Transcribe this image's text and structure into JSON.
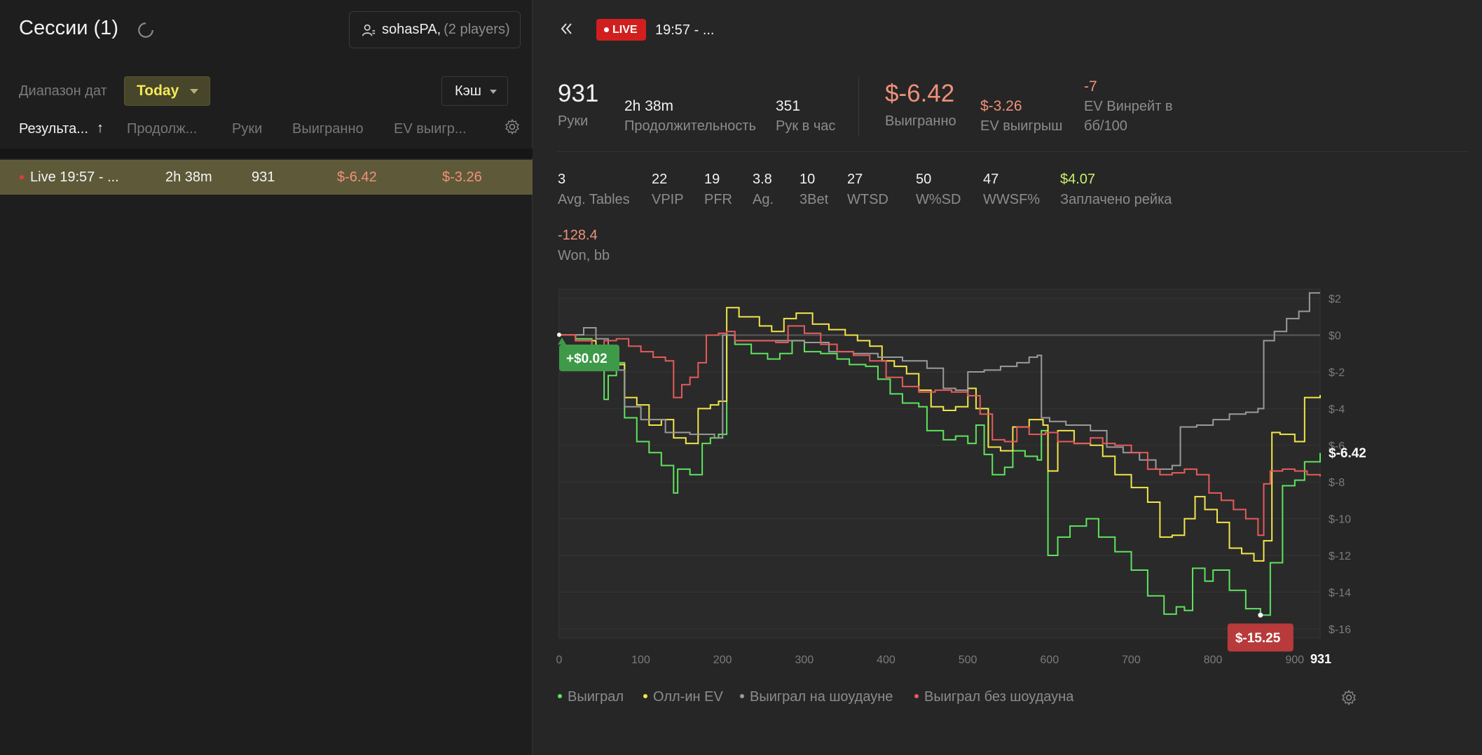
{
  "left": {
    "title": "Сессии (1)",
    "player_name": "sohasPA,",
    "player_count": "(2 players)",
    "date_range_label": "Диапазон дат",
    "date_range_value": "Today",
    "game_type": "Кэш",
    "columns": [
      "Результа...",
      "Продолж...",
      "Руки",
      "Выигранно",
      "EV выигр..."
    ],
    "sort_indicator": "↑",
    "sessions": [
      {
        "name": "Live 19:57 - ...",
        "duration": "2h 38m",
        "hands": "931",
        "won": "$-6.42",
        "ev_won": "$-3.26"
      }
    ]
  },
  "right": {
    "live_badge": "LIVE",
    "session_title": "19:57 - ...",
    "stats_main": [
      {
        "value": "931",
        "label": "Руки"
      },
      {
        "value": "2h 38m",
        "label": "Продолжительность"
      },
      {
        "value": "351",
        "label": "Рук в час"
      },
      {
        "value": "$-6.42",
        "label": "Выигранно"
      },
      {
        "value": "$-3.26",
        "label": "EV выигрыш"
      },
      {
        "value": "-7",
        "label_line1": "EV Винрейт в",
        "label_line2": "бб/100"
      }
    ],
    "stats_secondary": [
      {
        "value": "3",
        "label": "Avg. Tables"
      },
      {
        "value": "22",
        "label": "VPIP"
      },
      {
        "value": "19",
        "label": "PFR"
      },
      {
        "value": "3.8",
        "label": "Ag."
      },
      {
        "value": "10",
        "label": "3Bet"
      },
      {
        "value": "27",
        "label": "WTSD"
      },
      {
        "value": "50",
        "label": "W%SD"
      },
      {
        "value": "47",
        "label": "WWSF%"
      },
      {
        "value": "$4.07",
        "label": "Заплачено рейка"
      }
    ],
    "stats_extra": {
      "value": "-128.4",
      "label": "Won, bb"
    },
    "legend": [
      "Выиграл",
      "Олл-ин EV",
      "Выиграл на шоудауне",
      "Выиграл без шоудауна"
    ]
  },
  "colors": {
    "won": "#5ee35e",
    "allin_ev": "#f2e64a",
    "showdown": "#9a9a9a",
    "non_showdown": "#e85a5a",
    "accent_yellow": "#f3e85a",
    "negative": "#f0917a",
    "live_red": "#d11f1f"
  },
  "chart_data": {
    "type": "line",
    "xlim": [
      0,
      931
    ],
    "ylim": [
      -16.5,
      2.5
    ],
    "x_ticks": [
      "0",
      "100",
      "200",
      "300",
      "400",
      "500",
      "600",
      "700",
      "800",
      "900"
    ],
    "x_end_label": "931",
    "y_ticks": [
      "$2",
      "$0",
      "$-2",
      "$-4",
      "$-6",
      "$-8",
      "$-10",
      "$-12",
      "$-14",
      "$-16"
    ],
    "max_label": "+$0.02",
    "min_label": "$-15.25",
    "final_label": "$-6.42",
    "max_point": {
      "x": 0,
      "y": 0.02
    },
    "min_point": {
      "x": 858,
      "y": -15.25
    },
    "series": [
      {
        "name": "Выиграл",
        "color": "#5ee35e",
        "points": [
          [
            0,
            0.02
          ],
          [
            20,
            -0.2
          ],
          [
            40,
            -1.6
          ],
          [
            55,
            -3.5
          ],
          [
            60,
            -2.2
          ],
          [
            70,
            -1.5
          ],
          [
            80,
            -4.5
          ],
          [
            95,
            -5.8
          ],
          [
            110,
            -6.4
          ],
          [
            125,
            -7.1
          ],
          [
            140,
            -8.6
          ],
          [
            145,
            -7.3
          ],
          [
            160,
            -7.6
          ],
          [
            175,
            -5.9
          ],
          [
            185,
            -5.6
          ],
          [
            195,
            -5.4
          ],
          [
            205,
            0.0
          ],
          [
            215,
            -0.5
          ],
          [
            235,
            -1.0
          ],
          [
            255,
            -1.3
          ],
          [
            270,
            -1.0
          ],
          [
            285,
            -0.3
          ],
          [
            300,
            -0.9
          ],
          [
            320,
            -1.0
          ],
          [
            340,
            -1.3
          ],
          [
            355,
            -1.6
          ],
          [
            375,
            -1.7
          ],
          [
            390,
            -2.4
          ],
          [
            405,
            -3.2
          ],
          [
            420,
            -3.7
          ],
          [
            440,
            -3.9
          ],
          [
            450,
            -5.2
          ],
          [
            470,
            -5.7
          ],
          [
            485,
            -5.5
          ],
          [
            500,
            -5.9
          ],
          [
            510,
            -4.9
          ],
          [
            520,
            -6.5
          ],
          [
            530,
            -7.6
          ],
          [
            545,
            -7.2
          ],
          [
            555,
            -6.3
          ],
          [
            570,
            -6.6
          ],
          [
            585,
            -6.8
          ],
          [
            590,
            -5.2
          ],
          [
            598,
            -12.0
          ],
          [
            610,
            -11.0
          ],
          [
            625,
            -10.4
          ],
          [
            645,
            -10.0
          ],
          [
            660,
            -11.0
          ],
          [
            680,
            -11.8
          ],
          [
            700,
            -12.8
          ],
          [
            720,
            -14.2
          ],
          [
            740,
            -15.2
          ],
          [
            755,
            -14.8
          ],
          [
            765,
            -15.0
          ],
          [
            775,
            -12.7
          ],
          [
            790,
            -13.4
          ],
          [
            800,
            -12.8
          ],
          [
            820,
            -13.9
          ],
          [
            840,
            -14.9
          ],
          [
            858,
            -15.25
          ],
          [
            870,
            -12.4
          ],
          [
            885,
            -8.2
          ],
          [
            900,
            -7.9
          ],
          [
            912,
            -6.9
          ],
          [
            931,
            -6.42
          ]
        ]
      },
      {
        "name": "Олл-ин EV",
        "color": "#f2e64a",
        "points": [
          [
            0,
            0.02
          ],
          [
            20,
            -0.3
          ],
          [
            45,
            -1.2
          ],
          [
            60,
            -1.6
          ],
          [
            80,
            -3.4
          ],
          [
            95,
            -3.8
          ],
          [
            110,
            -4.9
          ],
          [
            125,
            -4.6
          ],
          [
            140,
            -5.6
          ],
          [
            155,
            -5.9
          ],
          [
            170,
            -4.0
          ],
          [
            185,
            -3.8
          ],
          [
            195,
            -3.6
          ],
          [
            205,
            1.5
          ],
          [
            220,
            1.0
          ],
          [
            245,
            0.5
          ],
          [
            260,
            0.2
          ],
          [
            275,
            0.9
          ],
          [
            290,
            1.2
          ],
          [
            310,
            0.6
          ],
          [
            330,
            0.3
          ],
          [
            350,
            0.0
          ],
          [
            365,
            -0.3
          ],
          [
            380,
            -0.6
          ],
          [
            395,
            -1.4
          ],
          [
            410,
            -1.7
          ],
          [
            425,
            -2.1
          ],
          [
            440,
            -3.0
          ],
          [
            455,
            -3.9
          ],
          [
            470,
            -4.1
          ],
          [
            485,
            -3.9
          ],
          [
            500,
            -2.9
          ],
          [
            510,
            -4.0
          ],
          [
            525,
            -6.1
          ],
          [
            540,
            -6.3
          ],
          [
            555,
            -5.0
          ],
          [
            575,
            -4.6
          ],
          [
            592,
            -4.9
          ],
          [
            598,
            -7.4
          ],
          [
            610,
            -5.2
          ],
          [
            630,
            -5.9
          ],
          [
            650,
            -6.0
          ],
          [
            665,
            -6.6
          ],
          [
            680,
            -7.6
          ],
          [
            700,
            -8.3
          ],
          [
            720,
            -9.1
          ],
          [
            735,
            -11.0
          ],
          [
            750,
            -10.9
          ],
          [
            765,
            -10.0
          ],
          [
            778,
            -8.8
          ],
          [
            790,
            -9.5
          ],
          [
            805,
            -10.2
          ],
          [
            820,
            -11.6
          ],
          [
            835,
            -11.9
          ],
          [
            850,
            -12.3
          ],
          [
            862,
            -11.2
          ],
          [
            872,
            -5.3
          ],
          [
            882,
            -5.4
          ],
          [
            900,
            -5.8
          ],
          [
            912,
            -3.4
          ],
          [
            931,
            -3.26
          ]
        ]
      },
      {
        "name": "Выиграл на шоудауне",
        "color": "#9a9a9a",
        "points": [
          [
            0,
            0.02
          ],
          [
            30,
            0.4
          ],
          [
            45,
            -0.2
          ],
          [
            60,
            -1.9
          ],
          [
            80,
            -3.9
          ],
          [
            100,
            -4.6
          ],
          [
            130,
            -5.3
          ],
          [
            160,
            -5.4
          ],
          [
            190,
            -5.6
          ],
          [
            200,
            0.0
          ],
          [
            215,
            -0.3
          ],
          [
            240,
            -0.3
          ],
          [
            270,
            -0.3
          ],
          [
            300,
            -0.4
          ],
          [
            330,
            -0.9
          ],
          [
            360,
            -1.0
          ],
          [
            390,
            -1.2
          ],
          [
            420,
            -1.4
          ],
          [
            450,
            -1.8
          ],
          [
            470,
            -2.9
          ],
          [
            485,
            -3.0
          ],
          [
            500,
            -2.0
          ],
          [
            520,
            -1.9
          ],
          [
            540,
            -1.7
          ],
          [
            560,
            -1.5
          ],
          [
            575,
            -1.2
          ],
          [
            585,
            -1.1
          ],
          [
            590,
            -4.5
          ],
          [
            600,
            -4.7
          ],
          [
            620,
            -4.9
          ],
          [
            650,
            -5.2
          ],
          [
            670,
            -6.1
          ],
          [
            690,
            -6.4
          ],
          [
            710,
            -6.8
          ],
          [
            730,
            -7.3
          ],
          [
            750,
            -7.1
          ],
          [
            760,
            -5.0
          ],
          [
            780,
            -4.9
          ],
          [
            800,
            -4.6
          ],
          [
            820,
            -4.3
          ],
          [
            840,
            -4.2
          ],
          [
            855,
            -4.0
          ],
          [
            862,
            -0.3
          ],
          [
            875,
            0.2
          ],
          [
            890,
            0.9
          ],
          [
            905,
            1.3
          ],
          [
            918,
            2.3
          ],
          [
            931,
            2.3
          ]
        ]
      },
      {
        "name": "Выиграл без шоудауна",
        "color": "#e85a5a",
        "points": [
          [
            0,
            0.02
          ],
          [
            20,
            -0.3
          ],
          [
            40,
            -0.6
          ],
          [
            55,
            -0.3
          ],
          [
            70,
            -0.2
          ],
          [
            85,
            -0.6
          ],
          [
            100,
            -0.9
          ],
          [
            115,
            -1.2
          ],
          [
            130,
            -1.4
          ],
          [
            140,
            -3.4
          ],
          [
            150,
            -2.7
          ],
          [
            160,
            -2.3
          ],
          [
            170,
            -1.5
          ],
          [
            180,
            0.0
          ],
          [
            195,
            0.1
          ],
          [
            205,
            0.2
          ],
          [
            215,
            -0.3
          ],
          [
            240,
            -0.3
          ],
          [
            265,
            -0.4
          ],
          [
            280,
            0.5
          ],
          [
            300,
            0.1
          ],
          [
            320,
            -0.5
          ],
          [
            340,
            -0.9
          ],
          [
            360,
            -1.1
          ],
          [
            380,
            -1.4
          ],
          [
            400,
            -2.3
          ],
          [
            420,
            -2.8
          ],
          [
            440,
            -3.1
          ],
          [
            460,
            -3.0
          ],
          [
            480,
            -3.1
          ],
          [
            500,
            -3.3
          ],
          [
            515,
            -4.3
          ],
          [
            530,
            -5.7
          ],
          [
            545,
            -5.8
          ],
          [
            560,
            -5.0
          ],
          [
            575,
            -5.4
          ],
          [
            595,
            -5.3
          ],
          [
            610,
            -5.8
          ],
          [
            630,
            -5.9
          ],
          [
            650,
            -5.6
          ],
          [
            665,
            -5.9
          ],
          [
            680,
            -6.0
          ],
          [
            700,
            -6.4
          ],
          [
            720,
            -7.3
          ],
          [
            735,
            -7.6
          ],
          [
            750,
            -7.5
          ],
          [
            765,
            -7.3
          ],
          [
            780,
            -7.6
          ],
          [
            795,
            -8.6
          ],
          [
            810,
            -9.0
          ],
          [
            825,
            -9.5
          ],
          [
            840,
            -10.0
          ],
          [
            855,
            -10.9
          ],
          [
            862,
            -8.1
          ],
          [
            870,
            -7.4
          ],
          [
            885,
            -7.3
          ],
          [
            900,
            -7.4
          ],
          [
            915,
            -7.6
          ],
          [
            931,
            -7.7
          ]
        ]
      }
    ]
  }
}
